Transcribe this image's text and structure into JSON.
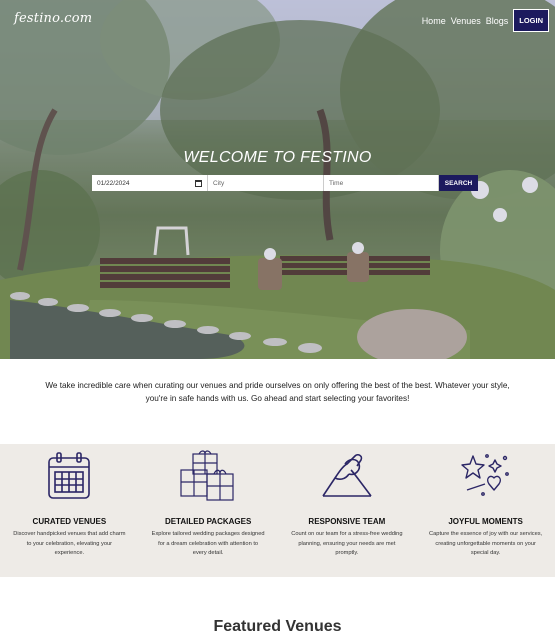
{
  "brand": {
    "logo": "festino.com"
  },
  "nav": {
    "links": [
      "Home",
      "Venues",
      "Blogs"
    ],
    "login": "LOGIN"
  },
  "hero": {
    "title": "WELCOME TO FESTINO",
    "search": {
      "date_value": "01/22/2024",
      "city_placeholder": "City",
      "time_placeholder": "Time",
      "button": "SEARCH"
    }
  },
  "intro": "We take incredible care when curating our venues and pride ourselves on only offering the best of the best. Whatever your style, you're in safe hands with us. Go ahead and start selecting your favorites!",
  "features": [
    {
      "icon": "calendar-icon",
      "title": "CURATED VENUES",
      "desc": "Discover handpicked venues that add charm to your celebration, elevating your experience."
    },
    {
      "icon": "gift-boxes-icon",
      "title": "DETAILED PACKAGES",
      "desc": "Explore tailored wedding packages designed for a dream celebration with attention to every detail."
    },
    {
      "icon": "handshake-icon",
      "title": "RESPONSIVE TEAM",
      "desc": "Count on our team for a stress-free wedding planning, ensuring your needs are met promptly."
    },
    {
      "icon": "sparkle-heart-icon",
      "title": "JOYFUL MOMENTS",
      "desc": "Capture the essence of joy with our services, creating unforgettable moments on your special day."
    }
  ],
  "featured_heading": "Featured Venues",
  "colors": {
    "primary": "#1c1a5e",
    "feature_bg": "#eeebe7",
    "icon_stroke": "#2b2666"
  }
}
